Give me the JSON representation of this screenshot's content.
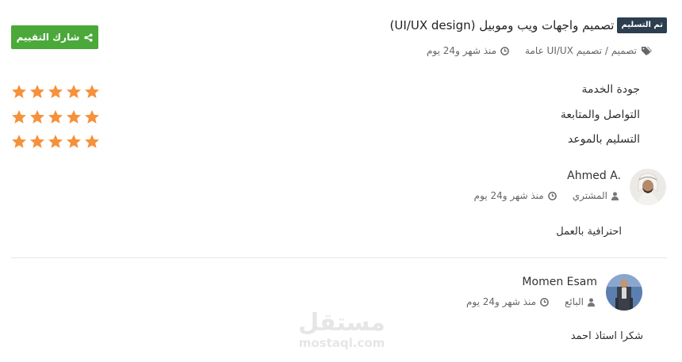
{
  "project": {
    "status_badge": "تم التسليم",
    "title": "تصميم واجهات ويب وموبيل (UI/UX design)",
    "category": "تصميم / تصميم UI/UX عامة",
    "time": "منذ شهر و24 يوم"
  },
  "share_button": {
    "label": "شارك التقييم",
    "icon": "share-icon"
  },
  "ratings": [
    {
      "label": "جودة الخدمة",
      "stars": 5
    },
    {
      "label": "التواصل والمتابعة",
      "stars": 5
    },
    {
      "label": "التسليم بالموعد",
      "stars": 5
    }
  ],
  "reviews": [
    {
      "name": "Ahmed A.",
      "role": "المشتري",
      "time": "منذ شهر و24 يوم",
      "comment": "احترافية بالعمل"
    },
    {
      "name": "Momen Esam",
      "role": "البائع",
      "time": "منذ شهر و24 يوم",
      "comment": "شكرا استاذ احمد"
    }
  ],
  "watermark": {
    "arabic": "مستقل",
    "latin": "mostaql.com"
  },
  "colors": {
    "badge": "#2c3e50",
    "share": "#4aa939",
    "star": "#f6913b",
    "meta": "#666666"
  }
}
